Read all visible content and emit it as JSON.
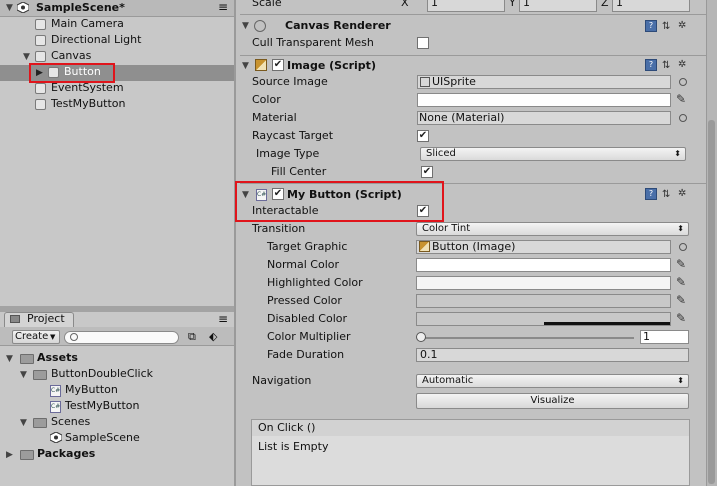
{
  "hierarchy": {
    "scene": "SampleScene*",
    "items": [
      "Main Camera",
      "Directional Light",
      "Canvas",
      "Button",
      "EventSystem",
      "TestMyButton"
    ]
  },
  "project": {
    "tab": "Project",
    "create_label": "Create",
    "assets_label": "Assets",
    "folder1": "ButtonDoubleClick",
    "file1": "MyButton",
    "file2": "TestMyButton",
    "scenes_label": "Scenes",
    "scene_file": "SampleScene",
    "packages_label": "Packages"
  },
  "inspector": {
    "scale": {
      "label": "Scale",
      "x_axis": "X",
      "x": "1",
      "y_axis": "Y",
      "y": "1",
      "z_axis": "Z",
      "z": "1"
    },
    "canvas_renderer": {
      "title": "Canvas Renderer",
      "cull_label": "Cull Transparent Mesh"
    },
    "image": {
      "title": "Image (Script)",
      "source_label": "Source Image",
      "source_value": "UISprite",
      "color_label": "Color",
      "material_label": "Material",
      "material_value": "None (Material)",
      "raycast_label": "Raycast Target",
      "image_type_label": "Image Type",
      "image_type_value": "Sliced",
      "fill_label": "Fill Center"
    },
    "my_button": {
      "title": "My Button (Script)",
      "interactable_label": "Interactable",
      "transition_label": "Transition",
      "transition_value": "Color Tint",
      "target_label": "Target Graphic",
      "target_value": "Button (Image)",
      "normal_label": "Normal Color",
      "highlighted_label": "Highlighted Color",
      "pressed_label": "Pressed Color",
      "disabled_label": "Disabled Color",
      "multiplier_label": "Color Multiplier",
      "multiplier_value": "1",
      "fade_label": "Fade Duration",
      "fade_value": "0.1",
      "navigation_label": "Navigation",
      "navigation_value": "Automatic",
      "visualize_label": "Visualize",
      "onclick_label": "On Click ()",
      "empty_label": "List is Empty"
    }
  },
  "colors": {
    "highlight": "#e0141b",
    "selected_row": "#8f8f8f"
  }
}
